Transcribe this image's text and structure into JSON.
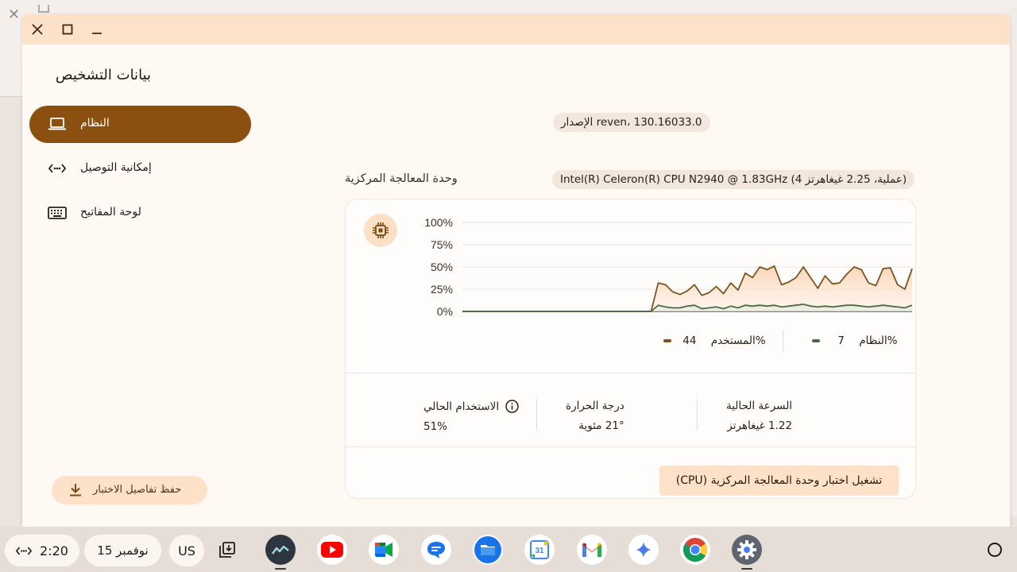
{
  "window": {
    "title": "بيانات التشخيص",
    "close_icon": "close-icon",
    "maximize_icon": "maximize-icon",
    "minimize_icon": "minimize-icon"
  },
  "sidebar": {
    "items": [
      {
        "label": "النظام",
        "icon": "laptop-icon",
        "active": true
      },
      {
        "label": "إمكانية التوصيل",
        "icon": "connectivity-icon",
        "active": false
      },
      {
        "label": "لوحة المفاتيح",
        "icon": "keyboard-icon",
        "active": false
      }
    ],
    "save_button_label": "حفظ تفاصيل الاختبار"
  },
  "main": {
    "version_chip": "الإصدار reven، 130.16033.0",
    "cpu_section_title": "وحدة المعالجة المركزية",
    "cpu_chip": "Intel(R) Celeron(R) CPU N2940 @ 1.83GHz (4 عملية، 2.25 غيغاهرتز)",
    "legend": {
      "user_label": "المستخدم",
      "user_value": "44%",
      "system_label": "النظام",
      "system_value": "7%"
    },
    "stats": {
      "current_usage_label": "الاستخدام الحالي",
      "current_usage_value": "51%",
      "temperature_label": "درجة الحرارة",
      "temperature_value": "21° مئوية",
      "current_speed_label": "السرعة الحالية",
      "current_speed_value": "1.22 غيغاهرتز"
    },
    "run_button_label": "تشغيل اختبار وحدة المعالجة المركزية (CPU)"
  },
  "colors": {
    "accent_brown": "#8b4f0f",
    "user_series": "#7a5421",
    "system_series": "#4e6a46",
    "chip_bg": "#f3e6dc",
    "button_bg": "#fde2c9"
  },
  "chart_data": {
    "type": "area",
    "title": "",
    "xlabel": "",
    "ylabel": "",
    "ylim": [
      0,
      100
    ],
    "yticks": [
      "0%",
      "25%",
      "50%",
      "75%",
      "100%"
    ],
    "grid": true,
    "series": [
      {
        "name": "المستخدم",
        "values": [
          0,
          0,
          0,
          0,
          0,
          0,
          0,
          0,
          0,
          0,
          0,
          0,
          0,
          0,
          0,
          0,
          0,
          0,
          0,
          0,
          0,
          0,
          0,
          0,
          0,
          0,
          0,
          32,
          30,
          22,
          19,
          23,
          30,
          18,
          21,
          28,
          20,
          32,
          24,
          43,
          38,
          50,
          47,
          51,
          30,
          33,
          38,
          50,
          38,
          26,
          40,
          31,
          32,
          42,
          50,
          47,
          32,
          29,
          48,
          49,
          30,
          25,
          48
        ]
      },
      {
        "name": "النظام",
        "values": [
          0,
          0,
          0,
          0,
          0,
          0,
          0,
          0,
          0,
          0,
          0,
          0,
          0,
          0,
          0,
          0,
          0,
          0,
          0,
          0,
          0,
          0,
          0,
          0,
          0,
          0,
          0,
          7,
          5,
          4,
          4,
          6,
          7,
          3,
          4,
          5,
          3,
          6,
          4,
          7,
          6,
          7,
          6,
          7,
          5,
          6,
          7,
          8,
          6,
          5,
          6,
          5,
          6,
          7,
          7,
          6,
          5,
          6,
          7,
          6,
          5,
          4,
          7
        ]
      }
    ]
  },
  "shelf": {
    "time": "2:20",
    "date": "15 نوفمبر",
    "keyboard_layout": "US",
    "apps": [
      "diagnostics-icon",
      "youtube-icon",
      "meet-icon",
      "messages-icon",
      "files-icon",
      "calendar-icon",
      "gmail-icon",
      "gemini-icon",
      "chrome-icon",
      "settings-icon"
    ],
    "calendar_day": "31"
  }
}
